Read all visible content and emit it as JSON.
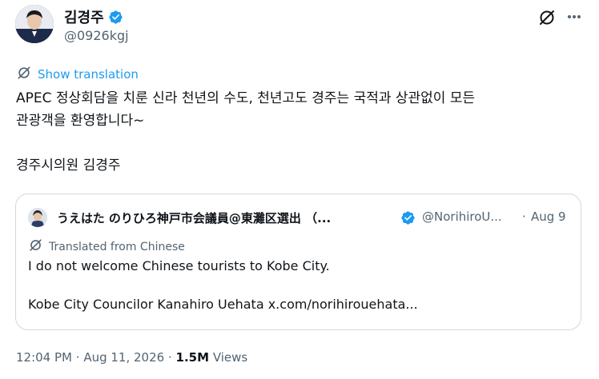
{
  "author": {
    "display_name": "김경주",
    "handle": "@0926kgj",
    "avatar_text": "김경주",
    "verified_icon": "verified-badge-icon",
    "accent_color": "#1d9bf0"
  },
  "header_actions": {
    "grok_icon": "grok-icon",
    "more_icon": "more-horizontal-icon"
  },
  "translation": {
    "label": "Show translation",
    "icon": "translate-globe-icon"
  },
  "tweet": {
    "line1": "APEC 정상회담을 치룬 신라 천년의 수도, 천년고도 경주는 국적과 상관없이 모든",
    "line2": "관광객을 환영합니다~",
    "line3": "경주시의원 김경주"
  },
  "quote": {
    "display_name": "うえはた のりひろ神戸市会議員@東灘区選出 （...",
    "handle": "@NorihiroU...",
    "separator": "·",
    "date": "Aug 9",
    "translated_label": "Translated from Chinese",
    "line1": "I do not welcome Chinese tourists to Kobe City.",
    "line2": "Kobe City Councilor Kanahiro Uehata x.com/norihirouehata..."
  },
  "meta": {
    "time": "12:04 PM",
    "separator": "·",
    "date": "Aug 11, 2026",
    "views_count": "1.5M",
    "views_label": "Views"
  },
  "colors": {
    "text_primary": "#0f1419",
    "text_secondary": "#536471",
    "link": "#1d9bf0",
    "border": "#cfd9de"
  }
}
